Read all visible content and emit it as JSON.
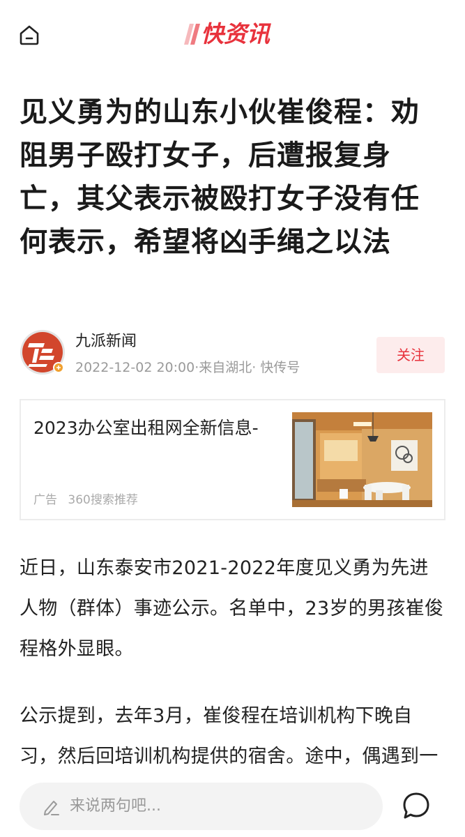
{
  "header": {
    "logo_text": "快资讯",
    "brand_color": "#e8323c"
  },
  "article": {
    "title": "见义勇为的山东小伙崔俊程：劝阻男子殴打女子，后遭报复身亡，其父表示被殴打女子没有任何表示，希望将凶手绳之以法",
    "author": {
      "name": "九派新闻",
      "meta": "2022-12-02 20:00·来自湖北· 快传号",
      "follow_label": "关注"
    },
    "paragraphs": [
      "近日，山东泰安市2021-2022年度见义勇为先进人物（群体）事迹公示。名单中，23岁的男孩崔俊程格外显眼。",
      "公示提到，去年3月，崔俊程在培训机构下晚自习，然后回培训机构提供的宿舍。途中，偶遇到一名男子与另一名女子，崔俊程上前"
    ]
  },
  "ad": {
    "title": "2023办公室出租网全新信息-",
    "tag": "广告",
    "source": "360搜索推荐"
  },
  "comment_bar": {
    "placeholder": "来说两句吧..."
  },
  "icons": {
    "home": "home-icon",
    "pen": "pen-icon",
    "comment": "comment-bubble-icon"
  }
}
